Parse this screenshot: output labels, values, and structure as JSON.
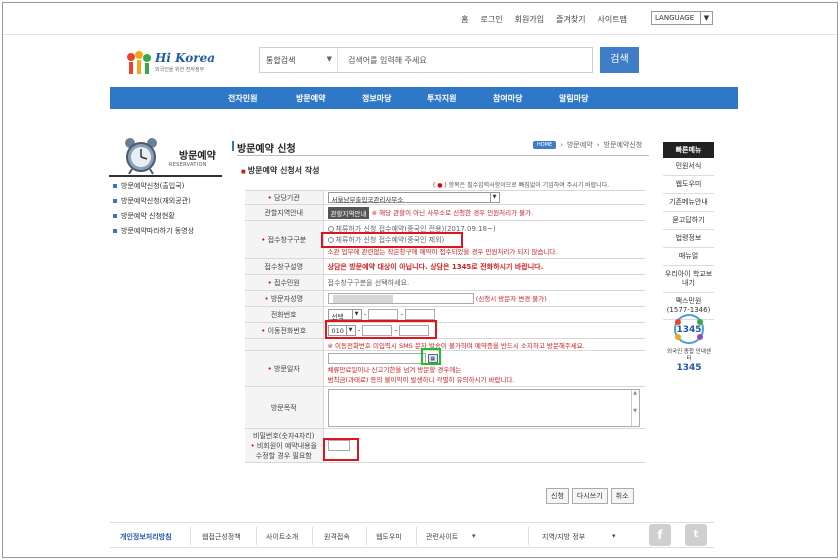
{
  "toplinks": [
    "홈",
    "로그인",
    "회원가입",
    "즐겨찾기",
    "사이트맵"
  ],
  "language": "LANGUAGE",
  "logo": {
    "name": "Hi Korea",
    "tagline": "외국인을 위한 전자정부"
  },
  "search": {
    "category": "통합검색",
    "placeholder": "검색어를 입력해 주세요",
    "button": "검색"
  },
  "nav": [
    "전자민원",
    "방문예약",
    "정보마당",
    "투자지원",
    "참여마당",
    "알림마당"
  ],
  "sidebar": {
    "title": "방문예약",
    "subtitle": "RESERVATION",
    "items": [
      "방문예약신청(출입국)",
      "방문예약신청(재외공관)",
      "방문예약 신청현황",
      "방문예약따라하기 동영상"
    ]
  },
  "main": {
    "title": "방문예약 신청",
    "breadcrumb": [
      "HOME",
      "방문예약",
      "방문예약신청"
    ],
    "subtitle": "방문예약 신청서 작성",
    "required_note_star": "( ● )",
    "required_note": " 항목은 필수입력사항이므로 빠짐없이 기입하여 주시기 바랍니다."
  },
  "form": {
    "office_label": "담당기관",
    "office_value": "서울남부출입국관리사무소",
    "area_label": "관할지역안내",
    "area_button": "관할지역안내",
    "area_note": "※ 해당 관할이 아닌 사무소로 신청한 경우 민원처리가 불가.",
    "counter_label": "접수창구구분",
    "counter_opt1": "체류허가 신청 접수예약(중국인 전용)(2017.09.18~)",
    "counter_opt2": "체류허가 신청 접수예약(중국인 제외)",
    "counter_note": "소관 업무에 관련없는 작은창구에 예약이 접수되었을 경우 민원처리가 되지 않습니다.",
    "counter_desc_label": "접수창구설명",
    "counter_desc": "상담은 방문예약 대상이 아닙니다. 상담은 1345로 전화하시기 바랍니다.",
    "civil_label": "접수민원",
    "civil_value": "접수창구구분을 선택하세요.",
    "visitor_label": "방문자성명",
    "visitor_note": "(신청시 방문자 변경 불가)",
    "phone_label": "전화번호",
    "phone_select": "선택",
    "mobile_label": "이동전화번호",
    "mobile_select": "010",
    "mobile_note": "※ 이동전화번호 미입력시 SMS 문자 발송이 불가하며 예약증을 반드시 소지하고 방문해주세요.",
    "date_label": "방문일자",
    "date_note1": "체류만료일이나 신고기한을 넘겨 방문할 경우에는",
    "date_note2": "범칙금(과태료) 등의 불이익이 발생하니 각별히 유의하시기 바랍니다.",
    "purpose_label": "방문목적",
    "password_label1": "비밀번호(숫자4자리)",
    "password_label2": "비회원이 예약내용을",
    "password_label3": "수정할 경우 필요함",
    "buttons": [
      "신청",
      "다시쓰기",
      "취소"
    ]
  },
  "quick": {
    "title": "빠른메뉴",
    "items": [
      "민원서식",
      "웹도우미",
      "기존메뉴안내",
      "묻고답하기",
      "법령정보",
      "매뉴얼",
      "우리아이 학교보내기",
      "팩스민원 (1577-1346)"
    ],
    "center_number": "1345",
    "center_text": "외국인 종합 안내센터",
    "center_number2": "1345"
  },
  "footer": [
    "개인정보처리방침",
    "웹접근성정책",
    "사이트소개",
    "원격접속",
    "웹도우미",
    "관련사이트",
    "지역/지방 정부"
  ],
  "colors": {
    "nav": "#2f78c8",
    "search_btn": "#3f7dc9",
    "highlight_red": "#e0141e",
    "highlight_green": "#19c12a"
  }
}
